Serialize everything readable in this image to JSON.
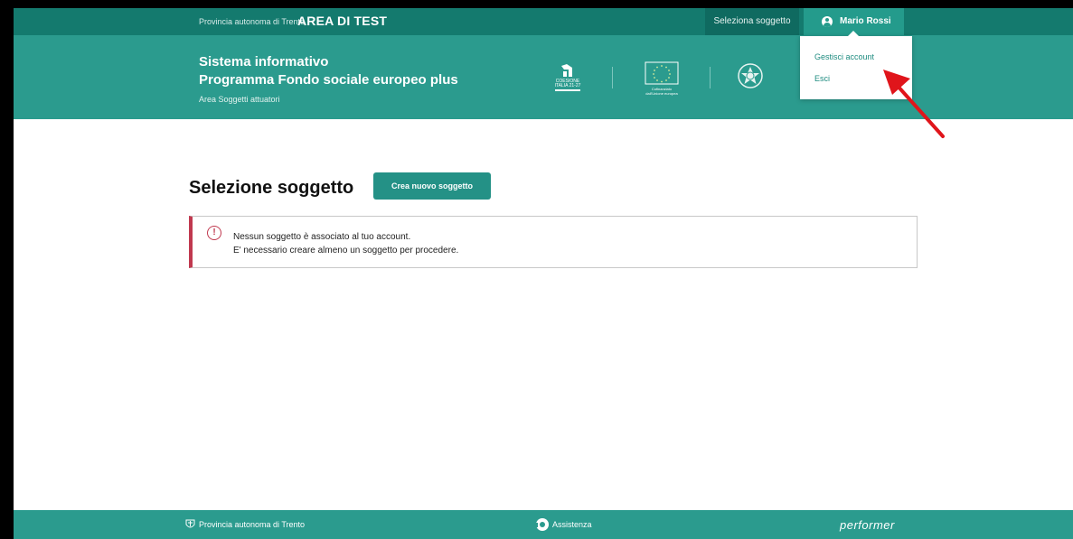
{
  "topbar": {
    "org_label": "Provincia autonoma di Trento",
    "env_label": "AREA DI TEST",
    "select_label": "Seleziona soggetto",
    "user_name": "Mario Rossi",
    "user_icon": "user-circle-icon"
  },
  "header": {
    "title_line1": "Sistema informativo",
    "title_line2": "Programma Fondo sociale europeo plus",
    "subtitle": "Area Soggetti attuatori",
    "logo_coesione_text": "COESIONE\nITALIA 21-27",
    "logo_eu_text": "Cofinanziato\ndall'Unione europea"
  },
  "dropdown": {
    "items": [
      {
        "label": "Gestisci account"
      },
      {
        "label": "Esci"
      }
    ]
  },
  "main": {
    "page_title": "Selezione soggetto",
    "create_button_label": "Crea nuovo soggetto",
    "alert": {
      "icon": "exclamation-circle-icon",
      "line1": "Nessun soggetto è associato al tuo account.",
      "line2": "E' necessario creare almeno un soggetto per procedere."
    }
  },
  "footer": {
    "org_label": "Provincia autonoma di Trento",
    "help_label": "Assistenza",
    "brand": "performer"
  },
  "colors": {
    "topbar": "#147a6e",
    "header": "#2b9b8e",
    "accent": "#249186",
    "alert_border": "#c0394f",
    "annotation_arrow": "#e0151b"
  }
}
